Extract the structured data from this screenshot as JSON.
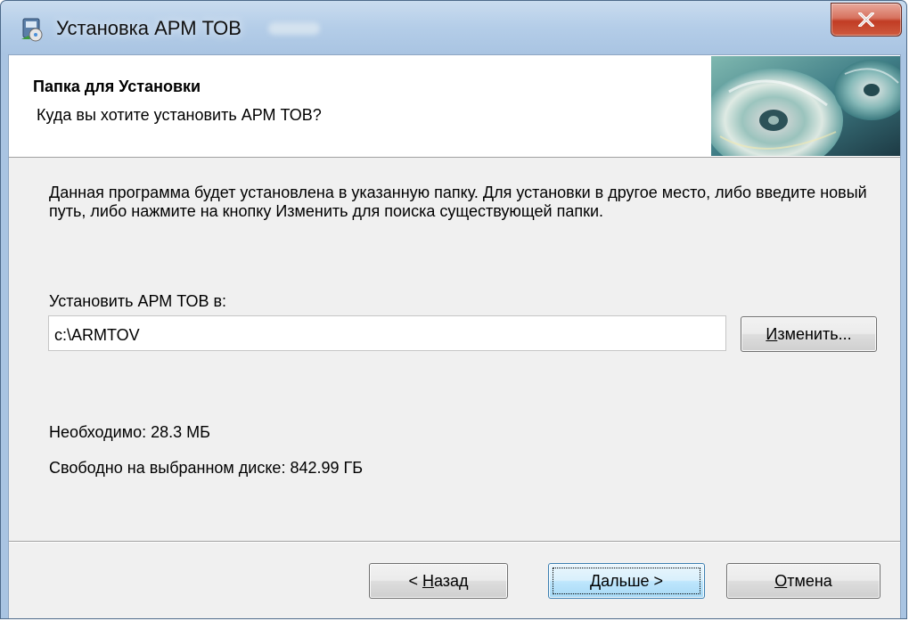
{
  "window": {
    "title": "Установка АРМ ТОВ",
    "close_symbol": "✕"
  },
  "header": {
    "title": "Папка для Установки",
    "subtitle": "Куда вы хотите установить АРМ ТОВ?",
    "art_icon": "disc-art-icon"
  },
  "body": {
    "description": "Данная программа будет установлена в указанную папку. Для установки в другое место, либо введите новый путь, либо нажмите на кнопку Изменить для поиска существующей папки.",
    "path_label": "Установить АРМ ТОВ в:",
    "path_value": "c:\\ARMTOV",
    "change_button": {
      "mnemonic": "И",
      "rest": "зменить..."
    },
    "required": "Необходимо: 28.3 МБ",
    "free": "Свободно на выбранном диске: 842.99 ГБ"
  },
  "footer": {
    "back": {
      "prefix": "< ",
      "mnemonic": "Н",
      "rest": "азад"
    },
    "next": {
      "prefix": "",
      "mnemonic": "Д",
      "rest": "альше >"
    },
    "cancel": {
      "prefix": "",
      "mnemonic": "О",
      "rest": "тмена"
    }
  },
  "colors": {
    "titlebar": "#b4cde8",
    "close_button": "#c13c24",
    "client_bg": "#f0f0f0",
    "default_button_border": "#3c7fb1"
  }
}
